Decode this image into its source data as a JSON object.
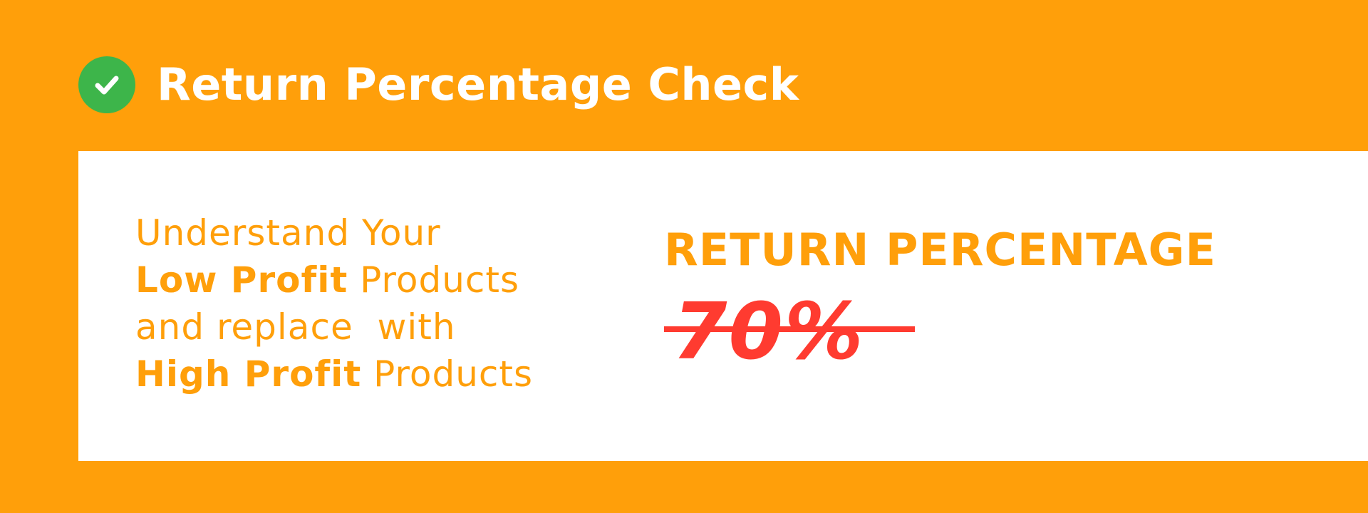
{
  "header": {
    "title": "Return Percentage Check",
    "icon": "check-circle-icon",
    "icon_color": "#3DB54A"
  },
  "tagline": {
    "line1": "Understand Your",
    "line2_bold": "Low Profit",
    "line2_rest": " Products",
    "line3": "and replace  with",
    "line4_bold": "High Profit",
    "line4_rest": " Products"
  },
  "stat": {
    "label": "RETURN PERCENTAGE",
    "value": "70%",
    "strikethrough": true
  },
  "colors": {
    "background": "#FF9F0A",
    "panel": "#FFFFFF",
    "accent": "#FF9F0A",
    "value": "#FF3B30"
  }
}
